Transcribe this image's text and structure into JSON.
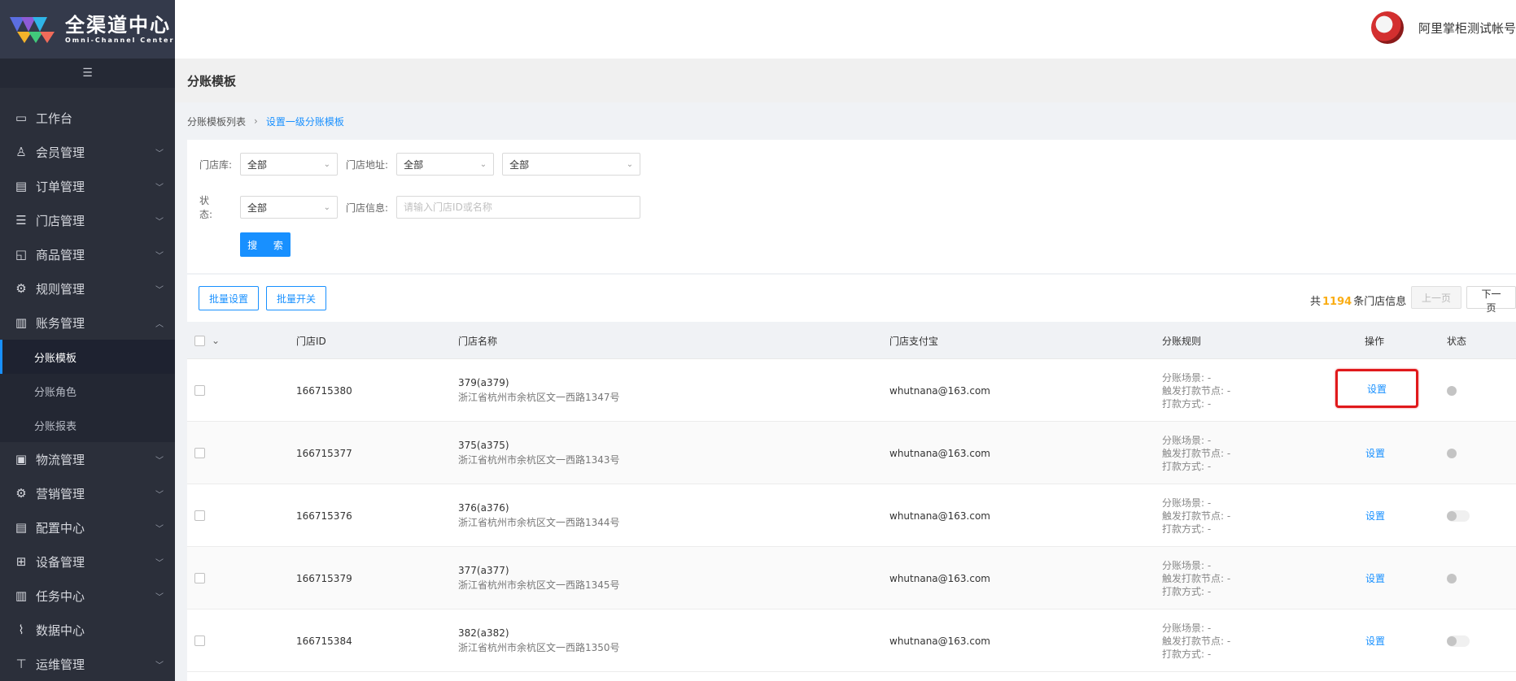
{
  "logo": {
    "title_cn": "全渠道中心",
    "title_en": "Omni-Channel Center"
  },
  "header": {
    "username": "阿里掌柜测试帐号"
  },
  "sidebar": {
    "items": [
      {
        "label": "工作台",
        "icon": "monitor-icon",
        "has_children": false
      },
      {
        "label": "会员管理",
        "icon": "members-icon",
        "has_children": true
      },
      {
        "label": "订单管理",
        "icon": "order-icon",
        "has_children": true
      },
      {
        "label": "门店管理",
        "icon": "list-icon",
        "has_children": true
      },
      {
        "label": "商品管理",
        "icon": "bag-icon",
        "has_children": true
      },
      {
        "label": "规则管理",
        "icon": "rules-icon",
        "has_children": true
      },
      {
        "label": "账务管理",
        "icon": "book-icon",
        "has_children": true,
        "expanded": true
      }
    ],
    "subitems": [
      {
        "label": "分账模板",
        "active": true
      },
      {
        "label": "分账角色",
        "active": false
      },
      {
        "label": "分账报表",
        "active": false
      }
    ],
    "items_after": [
      {
        "label": "物流管理",
        "icon": "truck-icon",
        "has_children": true
      },
      {
        "label": "营销管理",
        "icon": "marketing-icon",
        "has_children": true
      },
      {
        "label": "配置中心",
        "icon": "config-icon",
        "has_children": true
      },
      {
        "label": "设备管理",
        "icon": "grid-icon",
        "has_children": true
      },
      {
        "label": "任务中心",
        "icon": "task-icon",
        "has_children": true
      },
      {
        "label": "数据中心",
        "icon": "chart-icon",
        "has_children": false
      },
      {
        "label": "运维管理",
        "icon": "tool-icon",
        "has_children": true
      }
    ]
  },
  "page": {
    "title": "分账模板"
  },
  "breadcrumb": {
    "parent": "分账模板列表",
    "current": "设置一级分账模板"
  },
  "filters": {
    "store_lib_label": "门店库:",
    "store_lib_value": "全部",
    "address_label": "门店地址:",
    "address_value_1": "全部",
    "address_value_2": "全部",
    "status_label": "状　态:",
    "status_value": "全部",
    "info_label": "门店信息:",
    "info_placeholder": "请输入门店ID或名称",
    "search_label": "搜 索"
  },
  "toolbar": {
    "batch_set": "批量设置",
    "batch_switch": "批量开关",
    "total_prefix": "共",
    "total_count": "1194",
    "total_suffix": "条门店信息",
    "prev": "上一页",
    "next": "下一页"
  },
  "table": {
    "headers": {
      "store_id": "门店ID",
      "store_name": "门店名称",
      "alipay": "门店支付宝",
      "rule": "分账规则",
      "op": "操作",
      "status": "状态"
    },
    "rule_labels": {
      "scene": "分账场景: -",
      "node": "触发打款节点: -",
      "method": "打款方式: -"
    },
    "op_label": "设置",
    "rows": [
      {
        "id": "166715380",
        "name": "379(a379)",
        "address": "浙江省杭州市余杭区文一西路1347号",
        "alipay": "whutnana@163.com",
        "toggle": "dot"
      },
      {
        "id": "166715377",
        "name": "375(a375)",
        "address": "浙江省杭州市余杭区文一西路1343号",
        "alipay": "whutnana@163.com",
        "toggle": "dot"
      },
      {
        "id": "166715376",
        "name": "376(a376)",
        "address": "浙江省杭州市余杭区文一西路1344号",
        "alipay": "whutnana@163.com",
        "toggle": "track"
      },
      {
        "id": "166715379",
        "name": "377(a377)",
        "address": "浙江省杭州市余杭区文一西路1345号",
        "alipay": "whutnana@163.com",
        "toggle": "dot"
      },
      {
        "id": "166715384",
        "name": "382(a382)",
        "address": "浙江省杭州市余杭区文一西路1350号",
        "alipay": "whutnana@163.com",
        "toggle": "track"
      }
    ]
  }
}
